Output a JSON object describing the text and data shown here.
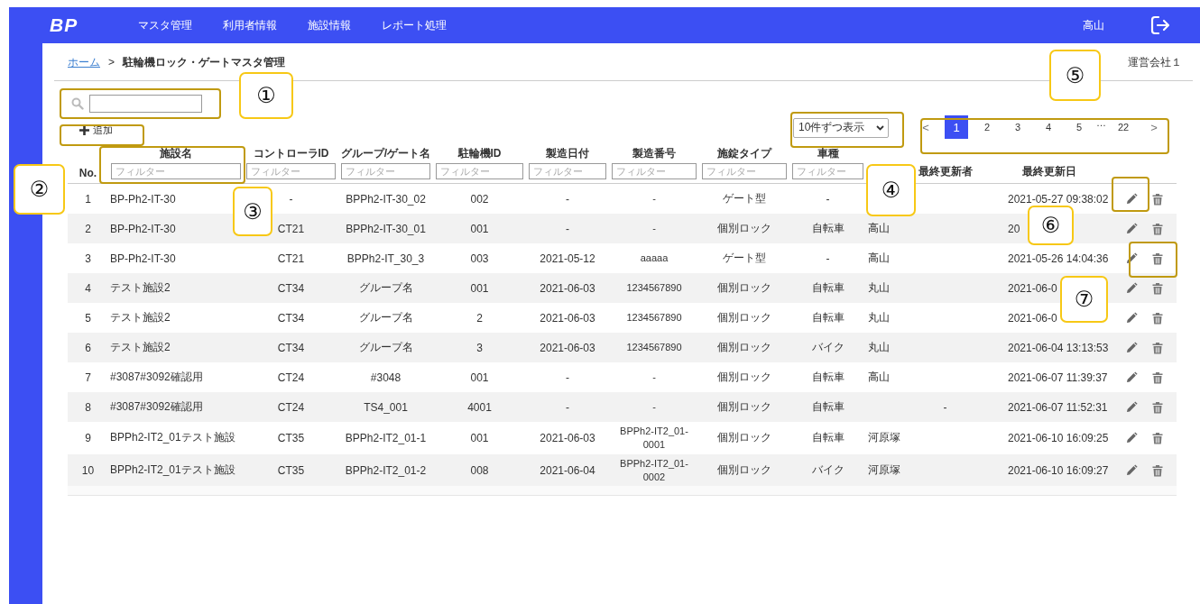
{
  "header": {
    "logo": "BP",
    "nav": [
      {
        "label": "マスタ管理"
      },
      {
        "label": "利用者情報"
      },
      {
        "label": "施設情報"
      },
      {
        "label": "レポート処理"
      }
    ],
    "user": "高山"
  },
  "breadcrumb": {
    "home": "ホーム",
    "separator": ">",
    "current": "駐輪機ロック・ゲートマスタ管理"
  },
  "company": "運営会社１",
  "search": {
    "kind": "empty"
  },
  "add_button": "追加",
  "per_page": "10件ずつ表示",
  "pagination": [
    {
      "kind": "prev",
      "label": "<",
      "selected": false
    },
    {
      "kind": "page",
      "label": "1",
      "selected": true
    },
    {
      "kind": "page",
      "label": "2",
      "selected": false
    },
    {
      "kind": "page",
      "label": "3",
      "selected": false
    },
    {
      "kind": "page",
      "label": "4",
      "selected": false
    },
    {
      "kind": "page",
      "label": "5",
      "selected": false
    },
    {
      "kind": "ellipsis",
      "label": "…"
    },
    {
      "kind": "page",
      "label": "22",
      "selected": false
    },
    {
      "kind": "next",
      "label": ">",
      "selected": false
    }
  ],
  "table": {
    "columns": [
      {
        "label": "No."
      },
      {
        "label": "施設名",
        "placeholder": "フィルター"
      },
      {
        "label": "コントローラID",
        "placeholder": "フィルター"
      },
      {
        "label": "グループ/ゲート名",
        "placeholder": "フィルター"
      },
      {
        "label": "駐輪機ID",
        "placeholder": "フィルター"
      },
      {
        "label": "製造日付",
        "placeholder": "フィルター"
      },
      {
        "label": "製造番号",
        "placeholder": "フィルター"
      },
      {
        "label": "施錠タイプ",
        "placeholder": "フィルター"
      },
      {
        "label": "車種",
        "placeholder": "フィルター"
      },
      {},
      {
        "label": "最終更新者"
      },
      {
        "label": "最終更新日"
      }
    ],
    "rows": [
      [
        "1",
        "BP-Ph2-IT-30",
        "-",
        "BPPh2-IT-30_02",
        "002",
        "-",
        "-",
        "ゲート型",
        "-",
        "",
        "",
        "2021-05-27 09:38:02"
      ],
      [
        "2",
        "BP-Ph2-IT-30",
        "CT21",
        "BPPh2-IT-30_01",
        "001",
        "-",
        "-",
        "個別ロック",
        "自転車",
        "高山",
        "",
        "20"
      ],
      [
        "3",
        "BP-Ph2-IT-30",
        "CT21",
        "BPPh2-IT_30_3",
        "003",
        "2021-05-12",
        "aaaaa",
        "ゲート型",
        "-",
        "高山",
        "",
        "2021-05-26 14:04:36"
      ],
      [
        "4",
        "テスト施設2",
        "CT34",
        "グループ名",
        "001",
        "2021-06-03",
        "1234567890",
        "個別ロック",
        "自転車",
        "丸山",
        "",
        "2021-06-0"
      ],
      [
        "5",
        "テスト施設2",
        "CT34",
        "グループ名",
        "2",
        "2021-06-03",
        "1234567890",
        "個別ロック",
        "自転車",
        "丸山",
        "",
        "2021-06-0"
      ],
      [
        "6",
        "テスト施設2",
        "CT34",
        "グループ名",
        "3",
        "2021-06-03",
        "1234567890",
        "個別ロック",
        "バイク",
        "丸山",
        "",
        "2021-06-04 13:13:53"
      ],
      [
        "7",
        "#3087#3092確認用",
        "CT24",
        "#3048",
        "001",
        "-",
        "-",
        "個別ロック",
        "自転車",
        "高山",
        "",
        "2021-06-07 11:39:37"
      ],
      [
        "8",
        "#3087#3092確認用",
        "CT24",
        "TS4_001",
        "4001",
        "-",
        "-",
        "個別ロック",
        "自転車",
        "",
        "-",
        "2021-06-07 11:52:31"
      ],
      [
        "9",
        "BPPh2-IT2_01テスト施設",
        "CT35",
        "BPPh2-IT2_01-1",
        "001",
        "2021-06-03",
        "BPPh2-IT2_01-0001",
        "個別ロック",
        "自転車",
        "河原塚",
        "",
        "2021-06-10 16:09:25"
      ],
      [
        "10",
        "BPPh2-IT2_01テスト施設",
        "CT35",
        "BPPh2-IT2_01-2",
        "008",
        "2021-06-04",
        "BPPh2-IT2_01-0002",
        "個別ロック",
        "バイク",
        "河原塚",
        "",
        "2021-06-10 16:09:27"
      ]
    ]
  },
  "annotations": [
    {
      "label": "①"
    },
    {
      "label": "②"
    },
    {
      "label": "③"
    },
    {
      "label": "④"
    },
    {
      "label": "⑤"
    },
    {
      "label": "⑥"
    },
    {
      "label": "⑦"
    }
  ]
}
